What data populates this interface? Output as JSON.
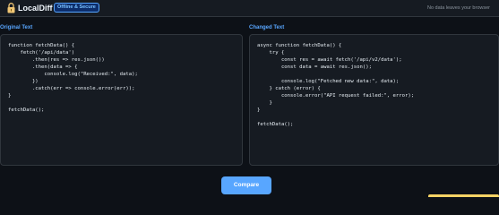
{
  "header": {
    "brand": "LocalDiff",
    "badge": "Offline & Secure",
    "privacy_note": "No data leaves your browser",
    "icon": "lock-icon"
  },
  "panels": {
    "original": {
      "label": "Original Text",
      "code": "function fetchData() {\n    fetch('/api/data')\n        .then(res => res.json())\n        .then(data => {\n            console.log(\"Received:\", data);\n        })\n        .catch(err => console.error(err));\n}\n\nfetchData();"
    },
    "changed": {
      "label": "Changed Text",
      "code": "async function fetchData() {\n    try {\n        const res = await fetch('/api/v2/data');\n        const data = await res.json();\n\n        console.log(\"Fetched new data:\", data);\n    } catch (error) {\n        console.error(\"API request failed:\", error);\n    }\n}\n\nfetchData();"
    }
  },
  "actions": {
    "compare_label": "Compare"
  },
  "colors": {
    "accent": "#58a6ff",
    "lock": "#f0c674",
    "background": "#0d1117",
    "panel": "#161b22"
  }
}
